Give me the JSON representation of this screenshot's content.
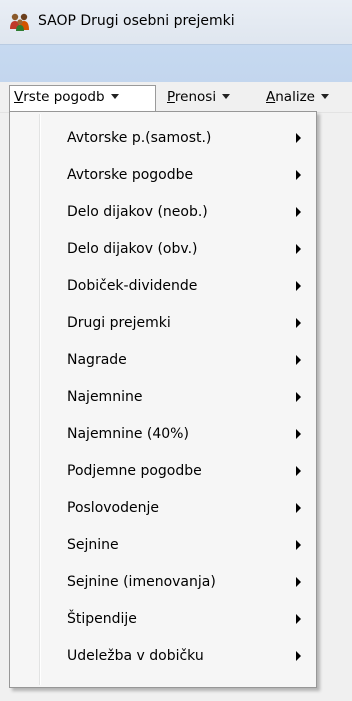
{
  "window": {
    "title": "SAOP Drugi osebni prejemki"
  },
  "menubar": {
    "items": [
      {
        "label": "Vrste pogodb",
        "underline": "V",
        "rest": "rste pogodb"
      },
      {
        "label": "Prenosi",
        "underline": "P",
        "rest": "renosi"
      },
      {
        "label": "Analize",
        "underline": "A",
        "rest": "nalize"
      }
    ]
  },
  "dropdown": {
    "items": [
      {
        "label": "Avtorske p.(samost.)"
      },
      {
        "label": "Avtorske pogodbe"
      },
      {
        "label": "Delo dijakov (neob.)"
      },
      {
        "label": "Delo dijakov (obv.)"
      },
      {
        "label": "Dobiček-dividende"
      },
      {
        "label": "Drugi prejemki"
      },
      {
        "label": "Nagrade"
      },
      {
        "label": "Najemnine"
      },
      {
        "label": "Najemnine (40%)"
      },
      {
        "label": "Podjemne pogodbe"
      },
      {
        "label": "Poslovodenje"
      },
      {
        "label": "Sejnine"
      },
      {
        "label": "Sejnine (imenovanja)"
      },
      {
        "label": "Štipendije"
      },
      {
        "label": "Udeležba v dobičku"
      }
    ]
  },
  "icons": {
    "app": "people-app-icon",
    "submenu": "submenu-arrow-icon",
    "dropdown": "chevron-down-icon"
  }
}
